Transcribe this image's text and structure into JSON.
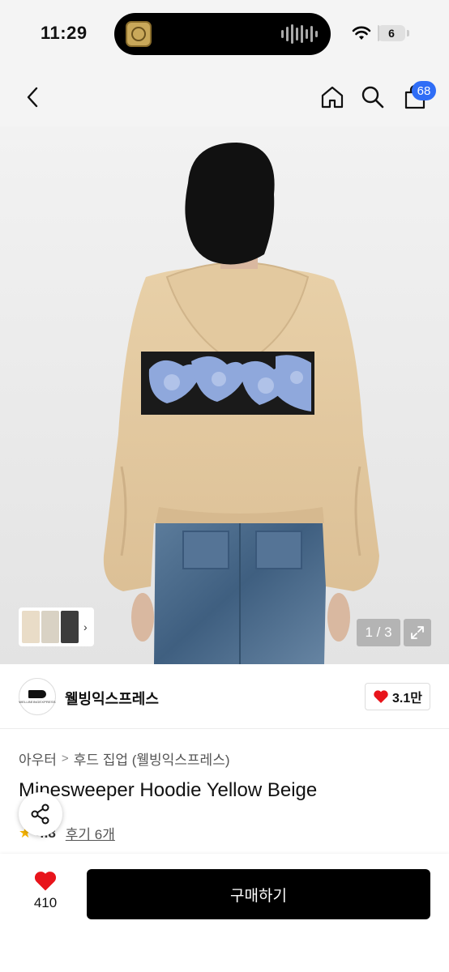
{
  "status_bar": {
    "time": "11:29",
    "battery_level": "6",
    "battery_fraction": 0.06,
    "island_app_icon": "gold-emblem-app-icon",
    "island_activity_icon": "audio-waveform-icon"
  },
  "nav": {
    "back_icon": "chevron-left-icon",
    "home_icon": "home-icon",
    "search_icon": "search-icon",
    "cart_icon": "shopping-bag-icon",
    "cart_count": "68",
    "badge_color": "#2f6df6"
  },
  "gallery": {
    "page_indicator": "1 / 3",
    "current_page": 1,
    "total_pages": 3,
    "expand_icon": "expand-arrows-icon",
    "thumb_arrow": "›"
  },
  "brand": {
    "name": "웰빙익스프레스",
    "logo_text": "WELLBEINGEXPRESS",
    "like_count": "3.1만",
    "heart_color": "#e8141b"
  },
  "product": {
    "category": "아우터",
    "separator": ">",
    "subcategory": "후드 집업 (웰빙익스프레스)",
    "title": "Minesweeper Hoodie Yellow Beige",
    "rating": "4.8",
    "review_link": "후기 6개"
  },
  "bottom_bar": {
    "wish_count": "410",
    "buy_label": "구매하기",
    "buy_color": "#000000"
  }
}
